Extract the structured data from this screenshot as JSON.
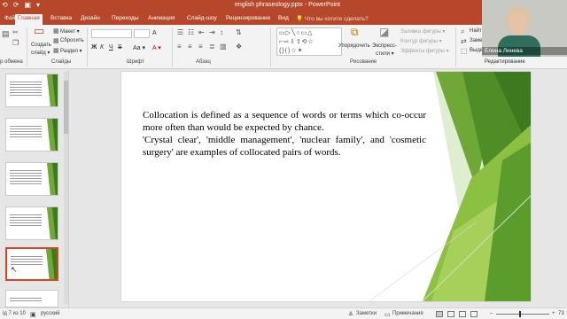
{
  "titlebar": {
    "title": "english phraseology.pptx  -  PowerPoint",
    "qat": [
      "⟲",
      "⟳",
      "▣",
      "▾"
    ]
  },
  "tabs": [
    {
      "label": "Файл"
    },
    {
      "label": "Главная"
    },
    {
      "label": "Вставка"
    },
    {
      "label": "Дизайн"
    },
    {
      "label": "Переходы"
    },
    {
      "label": "Анимация"
    },
    {
      "label": "Слайд-шоу"
    },
    {
      "label": "Рецензирование"
    },
    {
      "label": "Вид"
    }
  ],
  "tell_me": "Что вы хотите сделать?",
  "ribbon": {
    "clipboard_label": "р обмена",
    "slides_label": "Слайды",
    "font_label": "Шрифт",
    "paragraph_label": "Абзац",
    "drawing_label": "Рисование",
    "editing_label": "Редактирование",
    "new_slide": "Создать",
    "new_slide2": "слайд ▾",
    "layout": "Макет ▾",
    "reset": "Сбросить",
    "section": "Раздел ▾",
    "arrange": "Упорядочить",
    "quick_styles": "Экспресс-",
    "quick_styles2": "стили ▾",
    "shape_fill": "Заливка фигуры ▾",
    "shape_outline": "Контур фигуры ▾",
    "shape_effects": "Эффекты фигуры ▾",
    "find": "Найти",
    "replace": "Заме",
    "select": "Выде",
    "font_bold": "Ж",
    "font_italic": "К",
    "font_underline": "Ч",
    "font_strike": "S",
    "font_size_up": "A",
    "font_aa": "Aa ▾",
    "font_color": "A ▾"
  },
  "webcam": {
    "name": "Елена Линева"
  },
  "slide": {
    "paragraph1": "Collocation is defined as a sequence of words or terms which co-occur more often than would be expected by chance.",
    "paragraph2": " 'Crystal clear', 'middle management', 'nuclear family', and 'cosmetic surgery' are examples of collocated pairs of words."
  },
  "status": {
    "slide_counter": "ід 7 из 10",
    "language": "русский",
    "notes": "Заметки",
    "comments": "Примечания",
    "zoom": "73"
  },
  "colors": {
    "accent": "#b7472a",
    "green_dark": "#3d7a1f",
    "green_mid": "#6fa836",
    "green_light": "#a6d05a"
  }
}
